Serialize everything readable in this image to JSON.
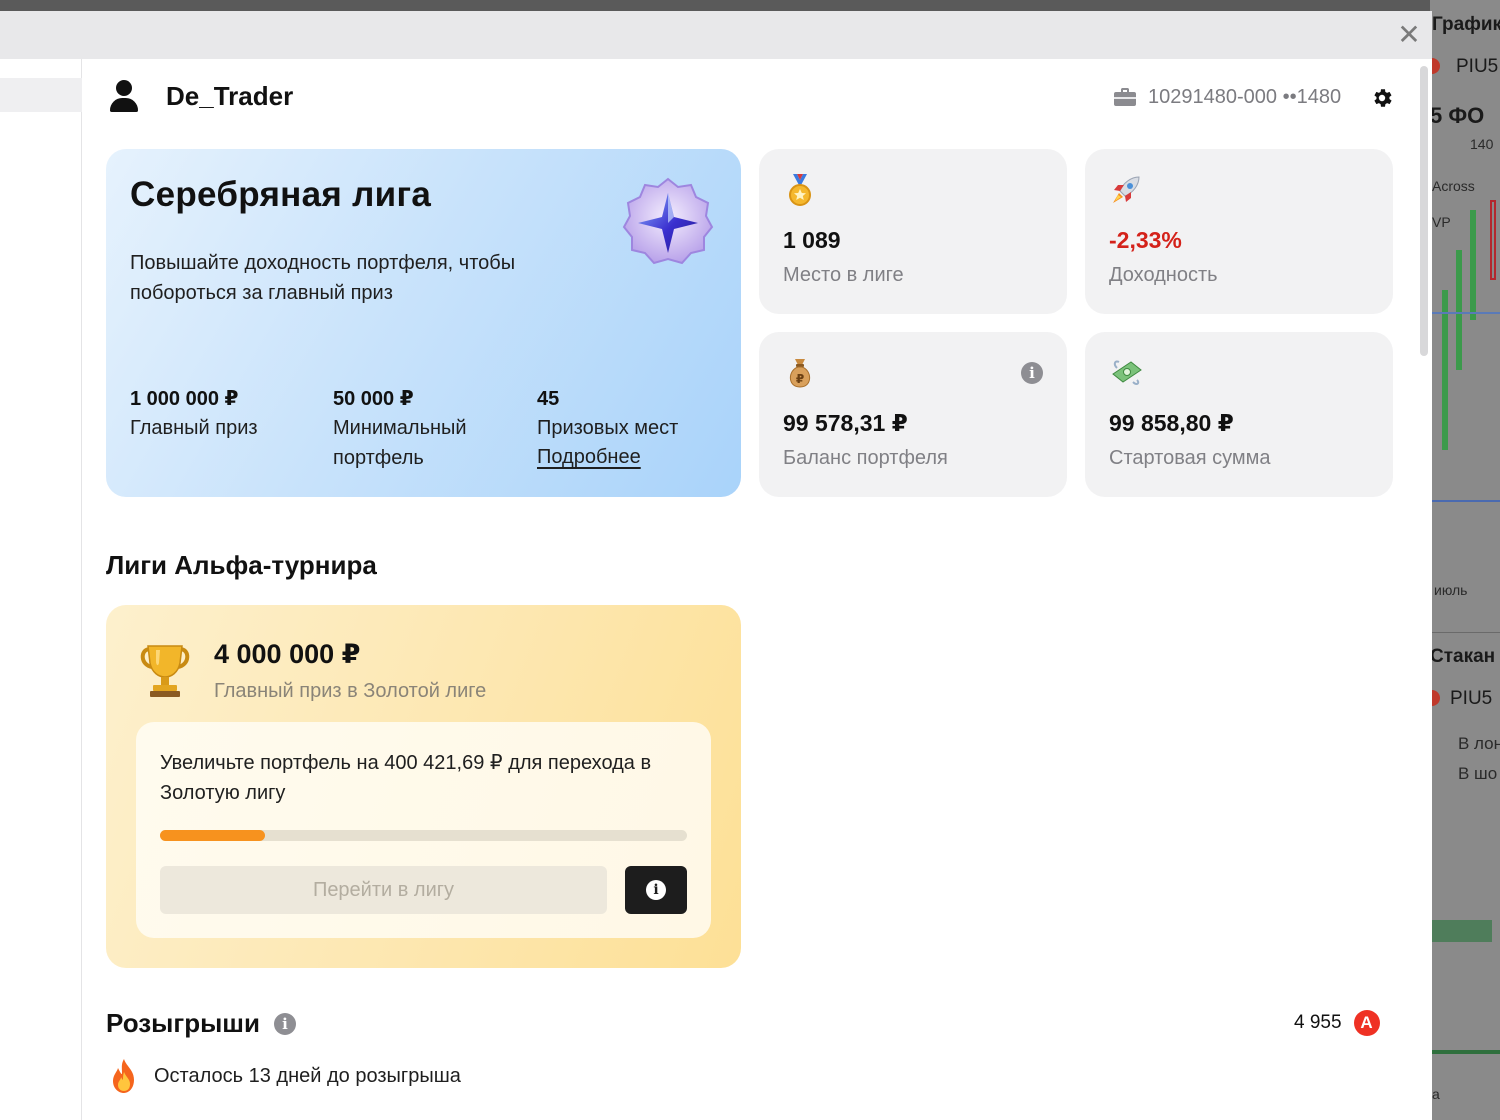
{
  "user": {
    "name": "De_Trader"
  },
  "account": {
    "number": "10291480-000 ••1480"
  },
  "close_symbol": "✕",
  "silver_league": {
    "title": "Серебряная лига",
    "description": "Повышайте доходность портфеля, чтобы побороться за главный приз",
    "stats": [
      {
        "value": "1 000 000 ₽",
        "label": "Главный приз"
      },
      {
        "value": "50 000 ₽",
        "label": "Минимальный портфель"
      },
      {
        "value": "45",
        "label": "Призовых мест"
      }
    ],
    "more_link": "Подробнее"
  },
  "cards": {
    "place": {
      "value": "1 089",
      "label": "Место в лиге",
      "icon": "medal-icon"
    },
    "yield": {
      "value": "-2,33%",
      "label": "Доходность",
      "icon": "rocket-icon",
      "color": "#d4221a"
    },
    "balance": {
      "value": "99 578,31 ₽",
      "label": "Баланс портфеля",
      "icon": "money-bag-icon"
    },
    "start": {
      "value": "99 858,80 ₽",
      "label": "Стартовая сумма",
      "icon": "flying-money-icon"
    }
  },
  "leagues_section": {
    "title": "Лиги Альфа-турнира",
    "gold_prize_value": "4 000 000 ₽",
    "gold_prize_label": "Главный приз в Золотой лиге",
    "upgrade_text": "Увеличьте портфель на 400 421,69 ₽ для перехода в Золотую лигу",
    "progress_percent": 20,
    "go_button": "Перейти в лигу"
  },
  "draws": {
    "title": "Розыгрыши",
    "points": "4 955",
    "points_icon_letter": "A",
    "countdown": "Осталось 13 дней до розыгрыша"
  },
  "background_app": {
    "chart_title": "График",
    "ticker": "PIU5",
    "ticker2": "PIU5",
    "orderbook": "Стакан",
    "month": "июль",
    "partial_a": "5 ФО",
    "partial_b": "140",
    "partial_c": "Across",
    "partial_d": "VP",
    "partial_e": "В лон",
    "partial_f": "В шо",
    "partial_g": "а"
  },
  "colors": {
    "accent_orange": "#f7921e",
    "alfa_red": "#ef3124",
    "negative": "#d4221a"
  }
}
